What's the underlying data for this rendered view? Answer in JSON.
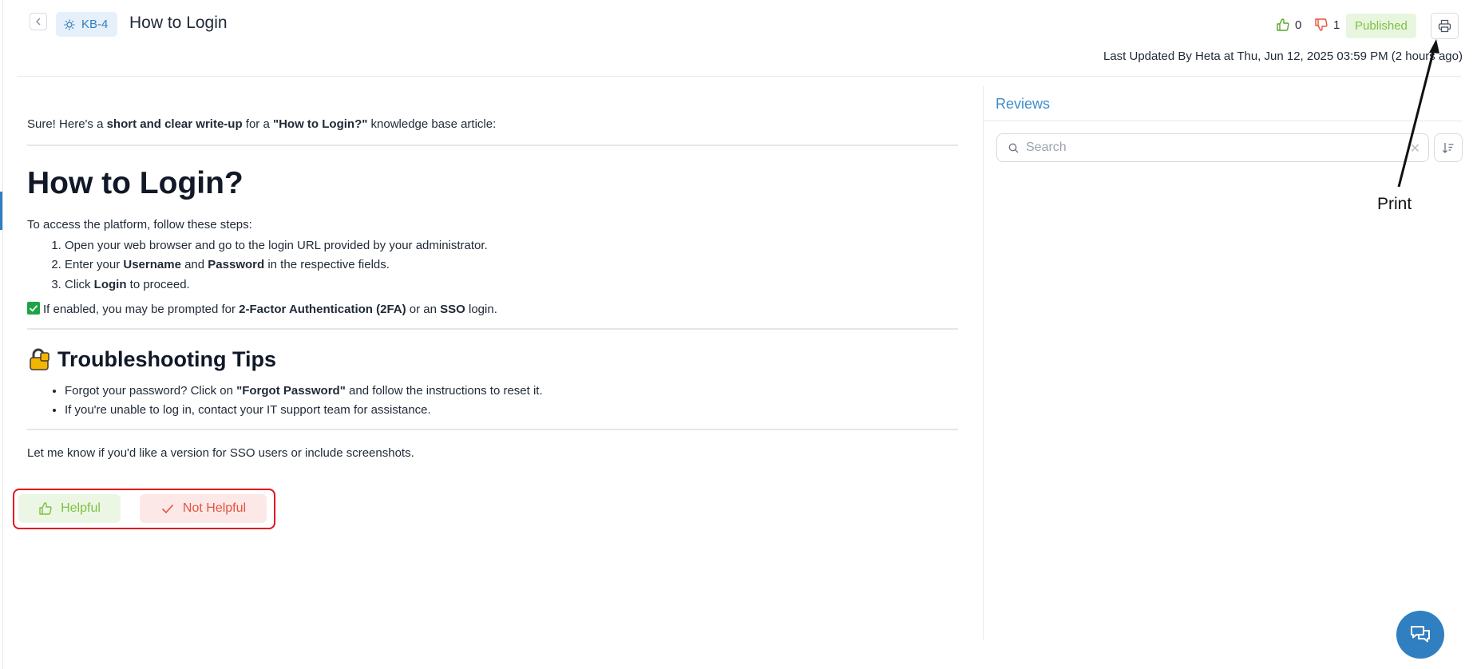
{
  "header": {
    "kb_id": "KB-4",
    "title": "How to Login",
    "thumbs_up_count": "0",
    "thumbs_down_count": "1",
    "status": "Published",
    "last_updated": "Last Updated By Heta at Thu, Jun 12, 2025 03:59 PM (2 hours ago)"
  },
  "article": {
    "intro_prefix": "Sure! Here's a ",
    "intro_bold1": "short and clear write-up",
    "intro_mid": " for a ",
    "intro_bold2": "\"How to Login?\"",
    "intro_suffix": " knowledge base article:",
    "heading": "How to Login?",
    "steps_intro": "To access the platform, follow these steps:",
    "step1": "Open your web browser and go to the login URL provided by your administrator.",
    "step2_a": "Enter your ",
    "step2_b": "Username",
    "step2_c": " and ",
    "step2_d": "Password",
    "step2_e": " in the respective fields.",
    "step3_a": "Click ",
    "step3_b": "Login",
    "step3_c": " to proceed.",
    "note_a": "If enabled, you may be prompted for ",
    "note_b": "2-Factor Authentication (2FA)",
    "note_c": " or an ",
    "note_d": "SSO",
    "note_e": " login.",
    "tips_heading": "Troubleshooting Tips",
    "tip1_a": "Forgot your password? Click on ",
    "tip1_b": "\"Forgot Password\"",
    "tip1_c": " and follow the instructions to reset it.",
    "tip2": "If you're unable to log in, contact your IT support team for assistance.",
    "closing": "Let me know if you'd like a version for SSO users or include screenshots."
  },
  "feedback": {
    "helpful_label": "Helpful",
    "not_helpful_label": "Not Helpful"
  },
  "reviews": {
    "title": "Reviews",
    "search_placeholder": "Search"
  },
  "annotation": {
    "label": "Print"
  },
  "colors": {
    "accent": "#2f7fc1",
    "published": "#7cc245",
    "not_helpful": "#e5533d",
    "highlight_frame": "#e3101d"
  },
  "icons": [
    "chevron-left-icon",
    "lightbulb-icon",
    "thumb-up-icon",
    "thumb-down-icon",
    "printer-icon",
    "search-icon",
    "close-icon",
    "sort-icon",
    "check-icon",
    "chat-icon"
  ]
}
